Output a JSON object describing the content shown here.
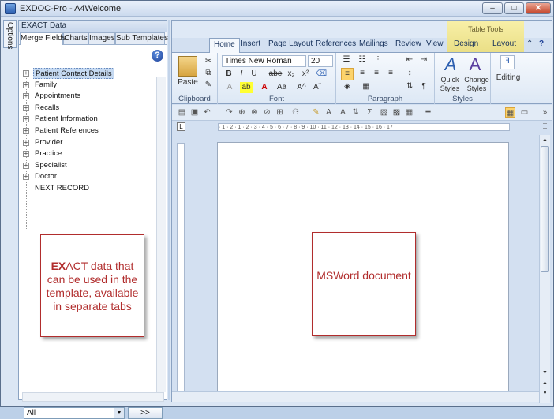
{
  "window": {
    "title": "EXDOC-Pro - A4Welcome",
    "buttons": {
      "minimize": "–",
      "maximize": "□",
      "close": "✕"
    }
  },
  "options_tab": "Options",
  "left_panel": {
    "title": "EXACT Data",
    "tabs": [
      "Merge Fields",
      "Charts",
      "Images",
      "Sub Templates"
    ],
    "help": "?",
    "tree": [
      {
        "label": "Patient Contact Details",
        "expander": "+"
      },
      {
        "label": "Family",
        "expander": "+"
      },
      {
        "label": "Appointments",
        "expander": "+"
      },
      {
        "label": "Recalls",
        "expander": "+"
      },
      {
        "label": "Patient Information",
        "expander": "+"
      },
      {
        "label": "Patient References",
        "expander": "+"
      },
      {
        "label": "Provider",
        "expander": "+"
      },
      {
        "label": "Practice",
        "expander": "+"
      },
      {
        "label": "Specialist",
        "expander": "+"
      },
      {
        "label": "Doctor",
        "expander": "+"
      },
      {
        "label": "NEXT RECORD",
        "expander": ""
      }
    ],
    "filter_value": "All",
    "go_button": ">>"
  },
  "callouts": {
    "left_bold": "EX",
    "left_rest": "ACT data that can be used in the template, available in separate tabs",
    "right": "MSWord document"
  },
  "ribbon": {
    "contextual_group": "Table Tools",
    "tabs": [
      "Home",
      "Insert",
      "Page Layout",
      "References",
      "Mailings",
      "Review",
      "View",
      "Design",
      "Layout"
    ],
    "groups": {
      "clipboard": {
        "label": "Clipboard",
        "paste": "Paste"
      },
      "font": {
        "label": "Font",
        "family": "Times New Roman",
        "size": "20",
        "bold": "B",
        "italic": "I",
        "underline": "U",
        "strike": "abe",
        "sub": "x₂",
        "sup": "x²",
        "grow": "A^",
        "shrink": "Aˇ",
        "case": "Aa"
      },
      "paragraph": {
        "label": "Paragraph",
        "pilcrow": "¶"
      },
      "styles": {
        "label": "Styles",
        "quick": "Quick Styles",
        "change": "Change Styles"
      },
      "editing": {
        "label": "Editing"
      }
    }
  },
  "ruler": {
    "marks": "· 1 · 2 · 1 · 2 · 3 · 4 · 5 · 6 · 7 · 8 · 9 · 10 · 11 · 12 · 13 · 14 · 15 · 16 · 17"
  },
  "ruler_corner": "L",
  "colors": {
    "callout_red": "#b12d2d",
    "accent_blue": "#1d3f96"
  }
}
